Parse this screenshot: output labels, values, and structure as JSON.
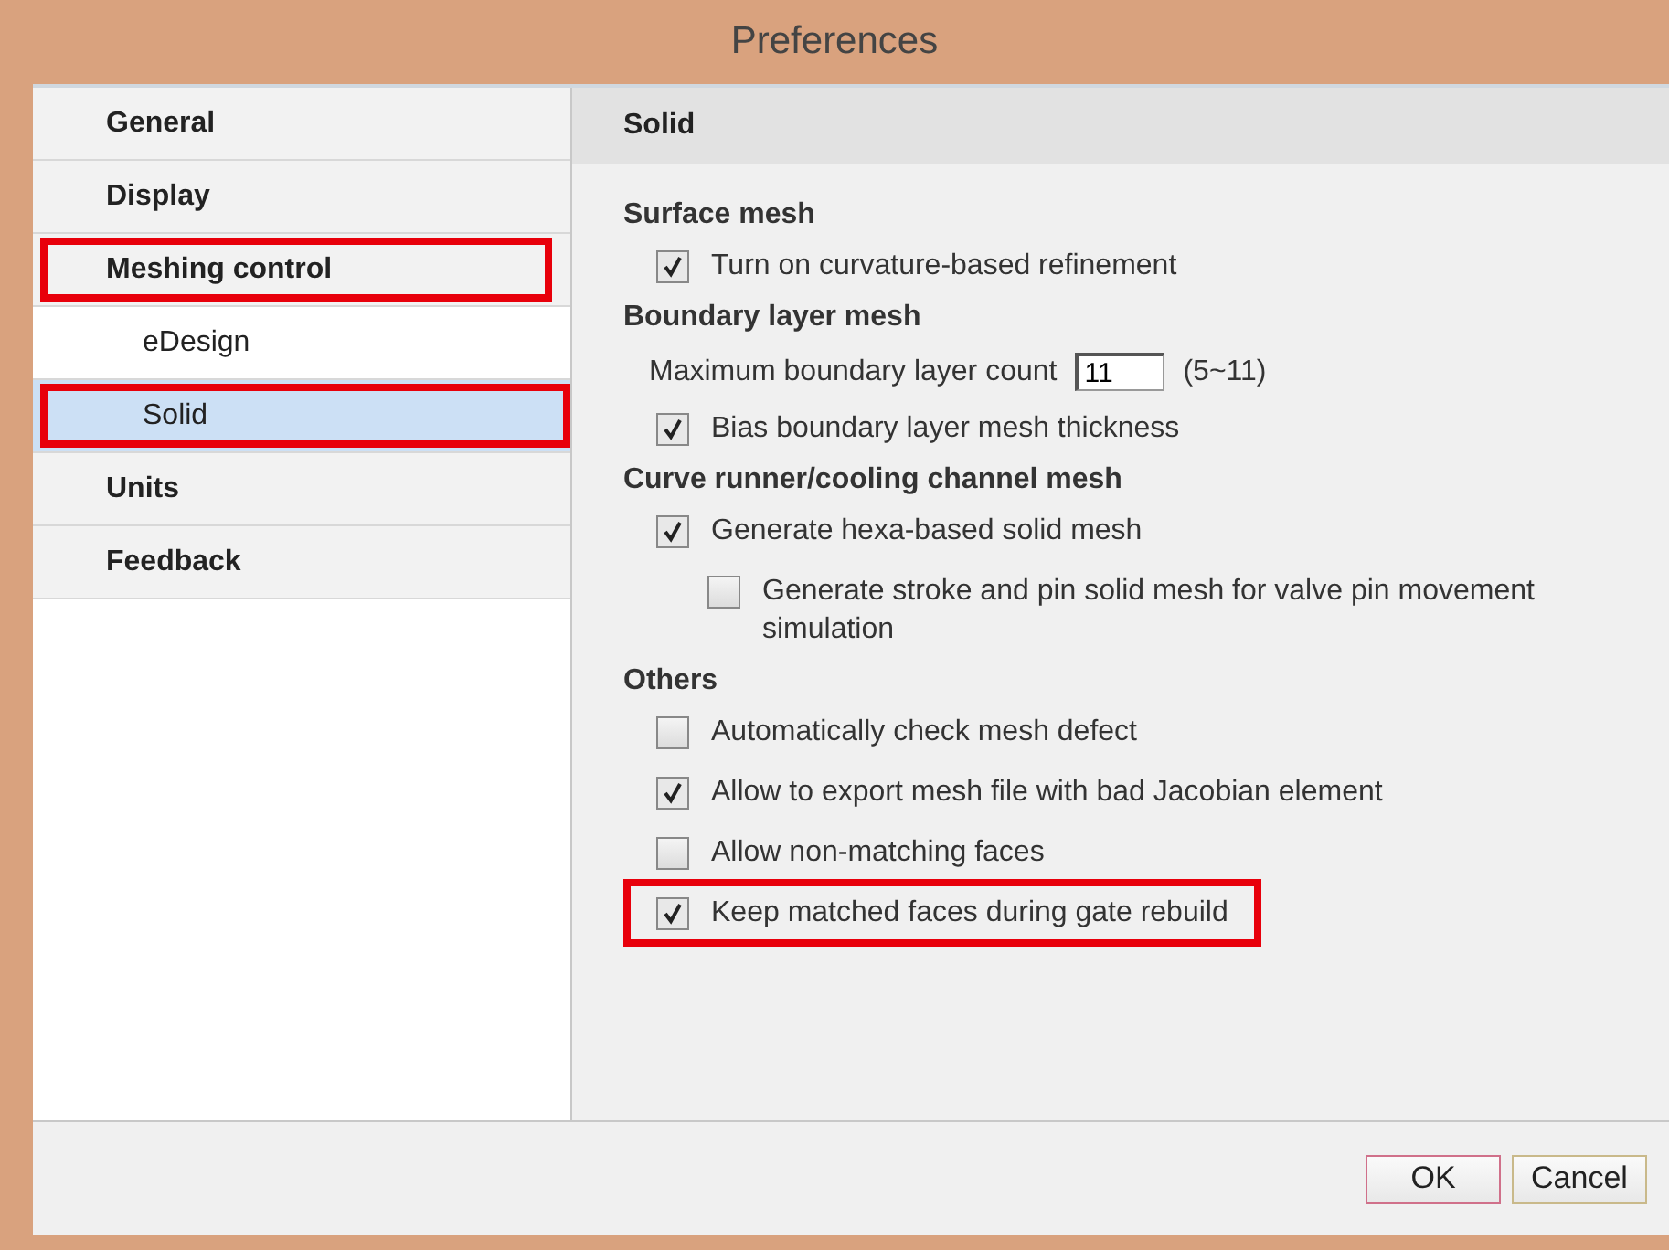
{
  "window": {
    "title": "Preferences"
  },
  "sidebar": {
    "items": [
      {
        "label": "General",
        "kind": "section",
        "selected": false,
        "highlighted": false
      },
      {
        "label": "Display",
        "kind": "section",
        "selected": false,
        "highlighted": false
      },
      {
        "label": "Meshing control",
        "kind": "section",
        "selected": false,
        "highlighted": true
      },
      {
        "label": "eDesign",
        "kind": "sub",
        "selected": false,
        "highlighted": false
      },
      {
        "label": "Solid",
        "kind": "sub",
        "selected": true,
        "highlighted": true
      },
      {
        "label": "Units",
        "kind": "section",
        "selected": false,
        "highlighted": false
      },
      {
        "label": "Feedback",
        "kind": "section",
        "selected": false,
        "highlighted": false
      }
    ]
  },
  "panel": {
    "title": "Solid",
    "sections": [
      {
        "title": "Surface mesh",
        "items": [
          {
            "kind": "checkbox",
            "label": "Turn on curvature-based refinement",
            "checked": true,
            "highlighted": false
          }
        ]
      },
      {
        "title": "Boundary layer mesh",
        "items": [
          {
            "kind": "number",
            "label": "Maximum boundary layer count",
            "value": "11",
            "range": "(5~11)"
          },
          {
            "kind": "checkbox",
            "label": "Bias boundary layer mesh thickness",
            "checked": true,
            "highlighted": false
          }
        ]
      },
      {
        "title": "Curve runner/cooling channel mesh",
        "items": [
          {
            "kind": "checkbox",
            "label": "Generate hexa-based solid mesh",
            "checked": true,
            "highlighted": false,
            "children": [
              {
                "kind": "checkbox",
                "label": "Generate stroke and pin solid mesh for valve pin movement simulation",
                "checked": false,
                "highlighted": false
              }
            ]
          }
        ]
      },
      {
        "title": "Others",
        "items": [
          {
            "kind": "checkbox",
            "label": "Automatically check mesh defect",
            "checked": false,
            "highlighted": false
          },
          {
            "kind": "checkbox",
            "label": "Allow to export mesh file with bad Jacobian element",
            "checked": true,
            "highlighted": false
          },
          {
            "kind": "checkbox",
            "label": "Allow non-matching faces",
            "checked": false,
            "highlighted": false
          },
          {
            "kind": "checkbox",
            "label": "Keep matched faces during gate rebuild",
            "checked": true,
            "highlighted": true
          }
        ]
      }
    ]
  },
  "buttons": [
    {
      "label": "OK",
      "kind": "default"
    },
    {
      "label": "Cancel",
      "kind": "normal"
    }
  ]
}
